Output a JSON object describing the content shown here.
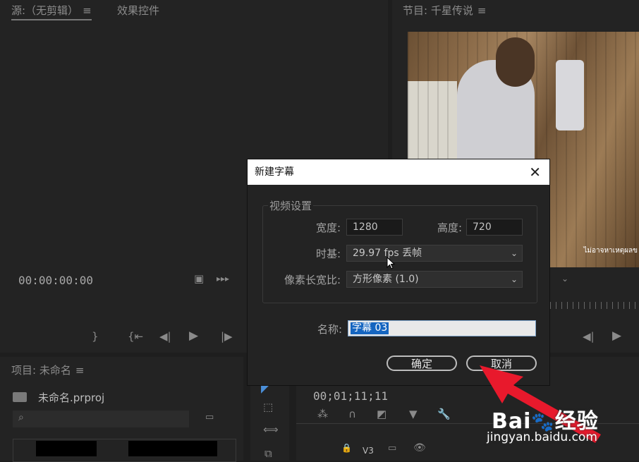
{
  "source_panel": {
    "tab_source": "源:（无剪辑）",
    "tab_effects": "效果控件",
    "timecode": "00:00:00:00"
  },
  "program_panel": {
    "title": "节目: 千星传说",
    "subtitle_overlay": "ไม่อาจหาเหตุผลข"
  },
  "project_panel": {
    "title": "项目: 未命名",
    "file": "未命名.prproj"
  },
  "timeline": {
    "timecode": "00;01;11;11",
    "track_v3": "V3"
  },
  "dialog": {
    "title": "新建字幕",
    "group_label": "视频设置",
    "width_label": "宽度:",
    "width_value": "1280",
    "height_label": "高度:",
    "height_value": "720",
    "timebase_label": "时基:",
    "timebase_value": "29.97 fps 丢帧",
    "par_label": "像素长宽比:",
    "par_value": "方形像素 (1.0)",
    "name_label": "名称:",
    "name_value": "字幕 03",
    "ok_label": "确定",
    "cancel_label": "取消"
  },
  "watermark": {
    "brand": "Bai",
    "brand2": "经验",
    "url": "jingyan.baidu.com"
  },
  "colors": {
    "accent_arrow": "#e8192c",
    "selection": "#1565c0"
  }
}
